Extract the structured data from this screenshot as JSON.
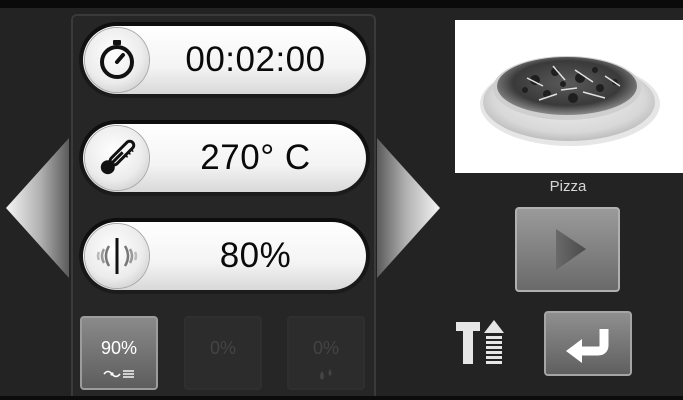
{
  "parameters": {
    "time": {
      "value": "00:02:00",
      "icon": "timer-icon"
    },
    "temperature": {
      "value": "270° C",
      "icon": "thermometer-icon"
    },
    "power": {
      "value": "80%",
      "icon": "microwave-icon"
    }
  },
  "tiles": [
    {
      "label": "90%",
      "icon": "fan-icon",
      "active": true
    },
    {
      "label": "0%",
      "icon": "",
      "active": false
    },
    {
      "label": "0%",
      "icon": "steam-drops-icon",
      "active": false
    }
  ],
  "recipe": {
    "name": "Pizza",
    "image": "pizza-photo"
  },
  "controls": {
    "start": "play-icon",
    "back": "return-arrow-icon",
    "preheat": "temperature-up-icon"
  },
  "colors": {
    "background": "#232323",
    "pill": "#f4f4f4",
    "button": "#7a7a7a",
    "text": "#0a0a0a"
  }
}
